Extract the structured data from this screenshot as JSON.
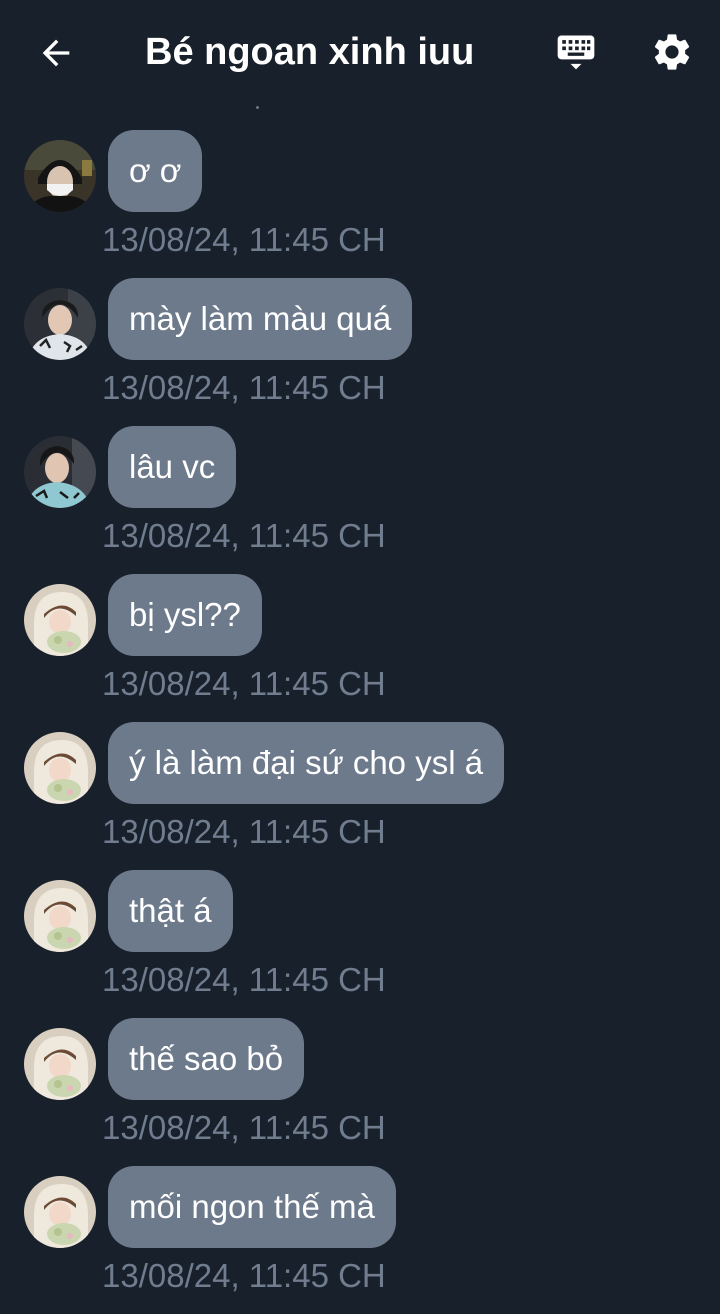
{
  "header": {
    "title": "Bé ngoan xinh iuu",
    "icons": [
      "arrow-left-icon",
      "keyboard-icon",
      "gear-icon"
    ]
  },
  "colors": {
    "background": "#18202b",
    "bubble": "#6d7a8c",
    "timestamp": "#707d8e",
    "text": "#ffffff"
  },
  "messages": [
    {
      "text": "ơ ơ",
      "time": "13/08/24, 11:45 CH",
      "avatar": "masked-person"
    },
    {
      "text": "mày làm màu quá",
      "time": "13/08/24, 11:45 CH",
      "avatar": "man-in-print-shirt"
    },
    {
      "text": "lâu vc",
      "time": "13/08/24, 11:45 CH",
      "avatar": "man-in-print-shirt"
    },
    {
      "text": "bị ysl??",
      "time": "13/08/24, 11:45 CH",
      "avatar": "girl-in-hoodie"
    },
    {
      "text": "ý là làm đại sứ cho ysl á",
      "time": "13/08/24, 11:45 CH",
      "avatar": "girl-in-hoodie"
    },
    {
      "text": "thật á",
      "time": "13/08/24, 11:45 CH",
      "avatar": "girl-in-hoodie"
    },
    {
      "text": "thế sao bỏ",
      "time": "13/08/24, 11:45 CH",
      "avatar": "girl-in-hoodie"
    },
    {
      "text": "mối ngon thế mà",
      "time": "13/08/24, 11:45 CH",
      "avatar": "girl-in-hoodie"
    }
  ]
}
